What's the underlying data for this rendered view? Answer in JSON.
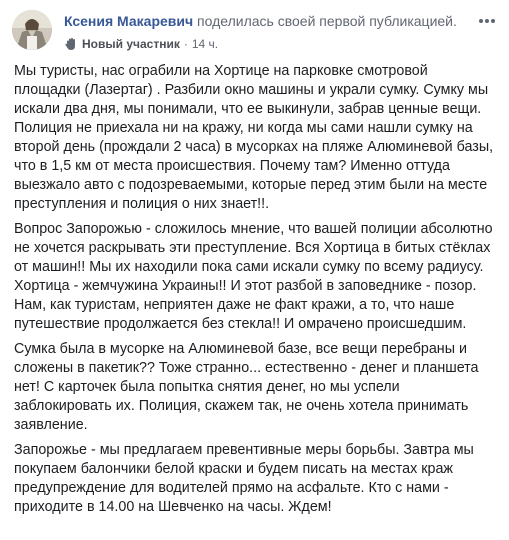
{
  "post": {
    "author": {
      "name": "Ксения Макаревич",
      "action": "поделилась своей первой публикацией."
    },
    "meta": {
      "badge_icon": "wave-hand-icon",
      "badge_label": "Новый участник",
      "separator": "·",
      "time": "14 ч."
    },
    "more_icon": "more-dots-icon",
    "paragraphs": [
      "Мы туристы, нас ограбили на Хортице на парковке смотровой площадки (Лазертаг) . Разбили окно машины и украли сумку. Сумку мы искали два дня, мы понимали, что ее выкинули, забрав ценные вещи. Полиция не приехала ни на кражу, ни когда мы сами нашли сумку на второй день (прождали 2 часа) в мусорках на пляже Алюминевой базы, что в 1,5 км от места происшествия. Почему там? Именно оттуда выезжало авто с подозреваемыми, которые перед этим были на месте преступления и полиция о них знает!!.",
      "Вопрос Запорожью - сложилось мнение, что вашей полиции абсолютно не хочется раскрывать эти преступление. Вся Хортица в битых стёклах от машин!! Мы их находили пока сами искали сумку по всему радиусу. Хортица - жемчужина Украины!! И этот разбой в заповеднике - позор. Нам, как туристам, неприятен даже не факт кражи, а то, что наше путешествие продолжается без стекла!! И омрачено происшедшим.",
      "Сумка была в мусорке на Алюминевой базе, все вещи перебраны и сложены в пакетик?? Тоже странно... естественно - денег и планшета нет! С карточек была попытка снятия денег, но мы успели заблокировать их. Полиция, скажем так, не очень хотела принимать заявление.",
      "Запорожье - мы предлагаем превентивные меры борьбы. Завтра мы покупаем балончики белой краски и будем писать на местах краж предупреждение для водителей прямо на асфальте. Кто с нами - приходите в 14.00 на Шевченко на часы. Ждем!"
    ]
  },
  "colors": {
    "author_link": "#385898",
    "meta_text": "#616770",
    "body_text": "#1c1e21"
  }
}
